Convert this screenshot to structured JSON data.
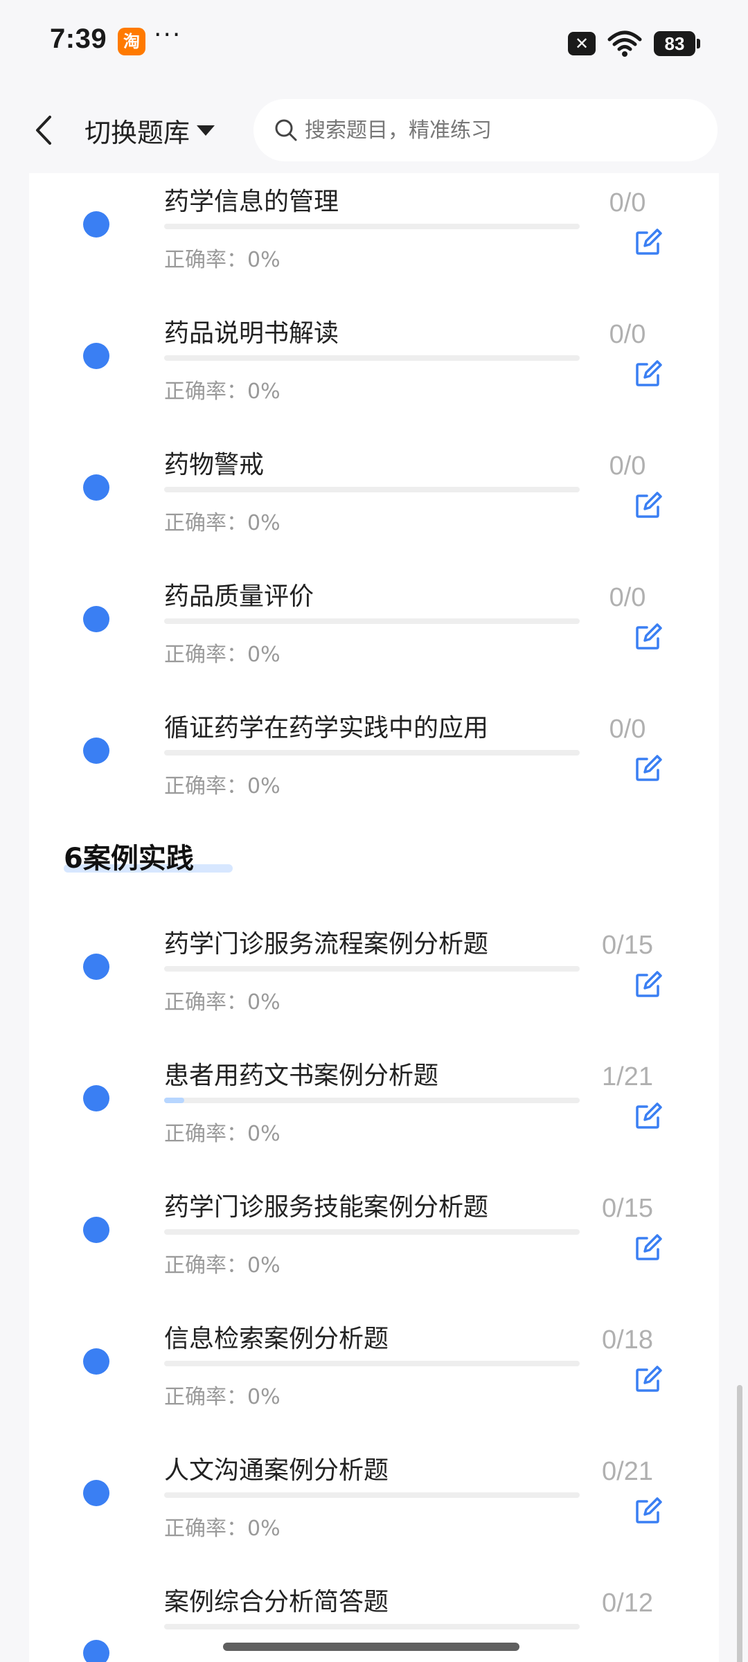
{
  "status_bar": {
    "time": "7:39",
    "taobao_badge": "淘",
    "more": "···",
    "sim_off_symbol": "✕",
    "battery": "83"
  },
  "nav": {
    "bank_switch_label": "切换题库",
    "search_placeholder": "搜索题目，精准练习"
  },
  "colors": {
    "accent": "#3a7ff3",
    "progress_fill": "#b7d6ff",
    "muted_text": "#9a9a9a"
  },
  "items_a": [
    {
      "title": "药学信息的管理",
      "accuracy": "正确率：0%",
      "count": "0/0",
      "progress": 0
    },
    {
      "title": "药品说明书解读",
      "accuracy": "正确率：0%",
      "count": "0/0",
      "progress": 0
    },
    {
      "title": "药物警戒",
      "accuracy": "正确率：0%",
      "count": "0/0",
      "progress": 0
    },
    {
      "title": "药品质量评价",
      "accuracy": "正确率：0%",
      "count": "0/0",
      "progress": 0
    },
    {
      "title": "循证药学在药学实践中的应用",
      "accuracy": "正确率：0%",
      "count": "0/0",
      "progress": 0
    }
  ],
  "section": {
    "heading": "6案例实践"
  },
  "items_b": [
    {
      "title": "药学门诊服务流程案例分析题",
      "accuracy": "正确率：0%",
      "count": "0/15",
      "progress": 0
    },
    {
      "title": "患者用药文书案例分析题",
      "accuracy": "正确率：0%",
      "count": "1/21",
      "progress": 0.0476
    },
    {
      "title": "药学门诊服务技能案例分析题",
      "accuracy": "正确率：0%",
      "count": "0/15",
      "progress": 0
    },
    {
      "title": "信息检索案例分析题",
      "accuracy": "正确率：0%",
      "count": "0/18",
      "progress": 0
    },
    {
      "title": "人文沟通案例分析题",
      "accuracy": "正确率：0%",
      "count": "0/21",
      "progress": 0
    },
    {
      "title": "案例综合分析简答题",
      "count": "0/12",
      "progress": 0
    }
  ]
}
